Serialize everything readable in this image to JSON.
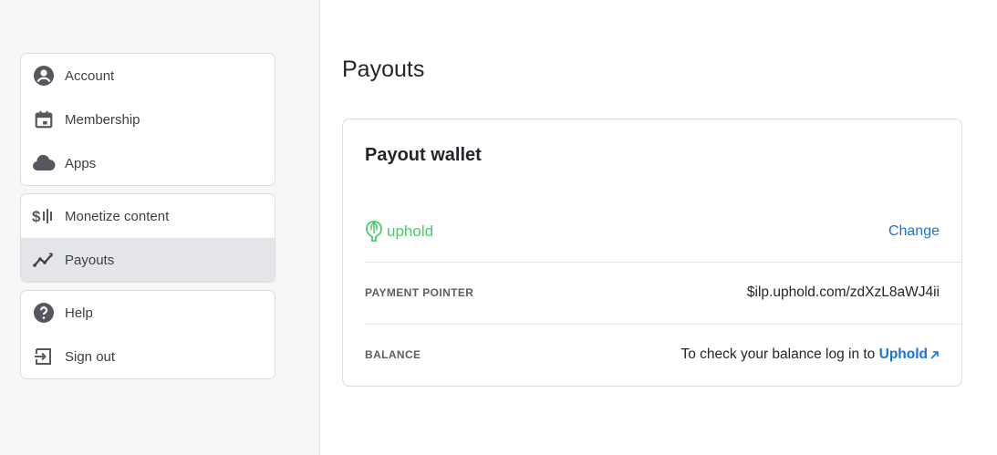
{
  "sidebar": {
    "group1": [
      {
        "label": "Account",
        "icon": "account-circle-icon"
      },
      {
        "label": "Membership",
        "icon": "calendar-icon"
      },
      {
        "label": "Apps",
        "icon": "cloud-icon"
      }
    ],
    "group2": [
      {
        "label": "Monetize content",
        "icon": "monetize-icon"
      },
      {
        "label": "Payouts",
        "icon": "trending-icon",
        "active": true
      }
    ],
    "group3": [
      {
        "label": "Help",
        "icon": "help-circle-icon"
      },
      {
        "label": "Sign out",
        "icon": "sign-out-icon"
      }
    ]
  },
  "main": {
    "title": "Payouts",
    "card": {
      "title": "Payout wallet",
      "wallet_name": "uphold",
      "change_label": "Change",
      "payment_pointer_label": "PAYMENT POINTER",
      "payment_pointer_value": "$ilp.uphold.com/zdXzL8aWJ4ii",
      "balance_label": "BALANCE",
      "balance_text": "To check your balance log in to ",
      "balance_link": "Uphold"
    }
  },
  "colors": {
    "accent": "#1a73d9",
    "uphold_green": "#49cc68",
    "active_bg": "#e4e5e8"
  }
}
